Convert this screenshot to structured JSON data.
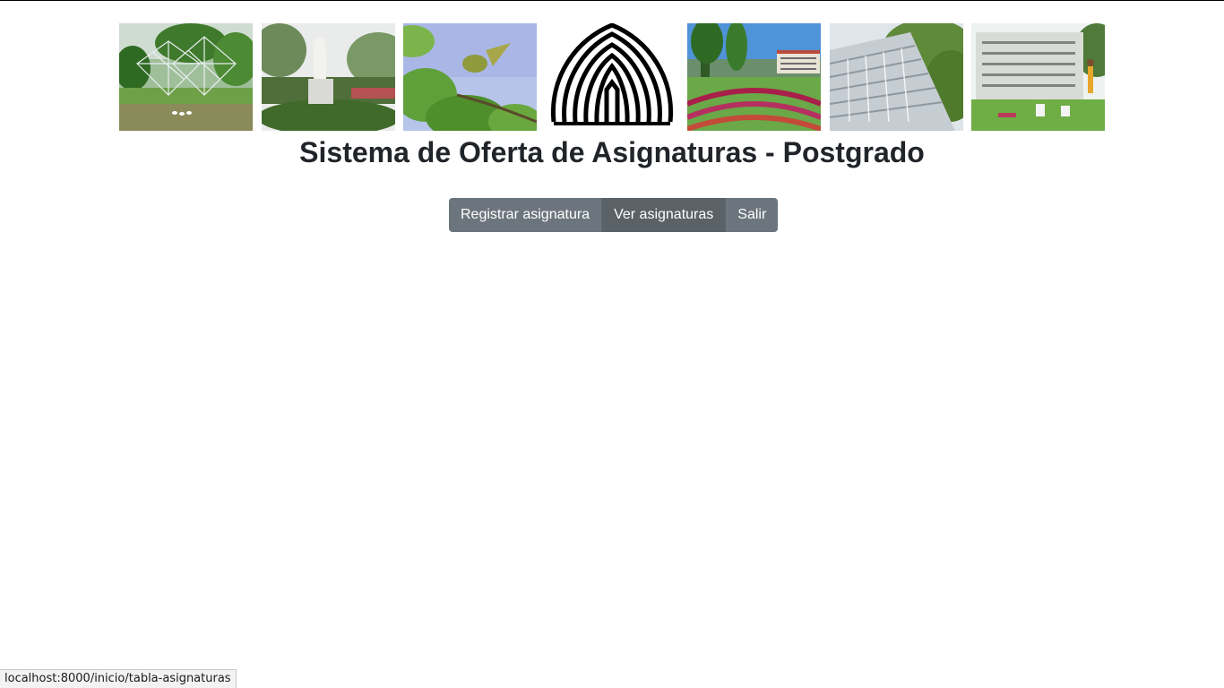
{
  "page": {
    "title": "Sistema de Oferta de Asignaturas - Postgrado"
  },
  "banner": {
    "photos": [
      {
        "name": "glass-sculpture-pond-photo"
      },
      {
        "name": "white-statue-garden-photo"
      },
      {
        "name": "bird-on-branch-photo"
      },
      {
        "name": "campus-gardens-photo"
      },
      {
        "name": "fountain-cascade-photo"
      },
      {
        "name": "university-building-photo"
      }
    ],
    "logo": "university-logo"
  },
  "nav": {
    "buttons": [
      {
        "label": "Registrar asignatura"
      },
      {
        "label": "Ver asignaturas"
      },
      {
        "label": "Salir"
      }
    ]
  },
  "status_bar": {
    "url": "localhost:8000/inicio/tabla-asignaturas"
  },
  "colors": {
    "button_bg": "#6c757d",
    "button_active_bg": "#5a6268",
    "title_text": "#212529"
  }
}
